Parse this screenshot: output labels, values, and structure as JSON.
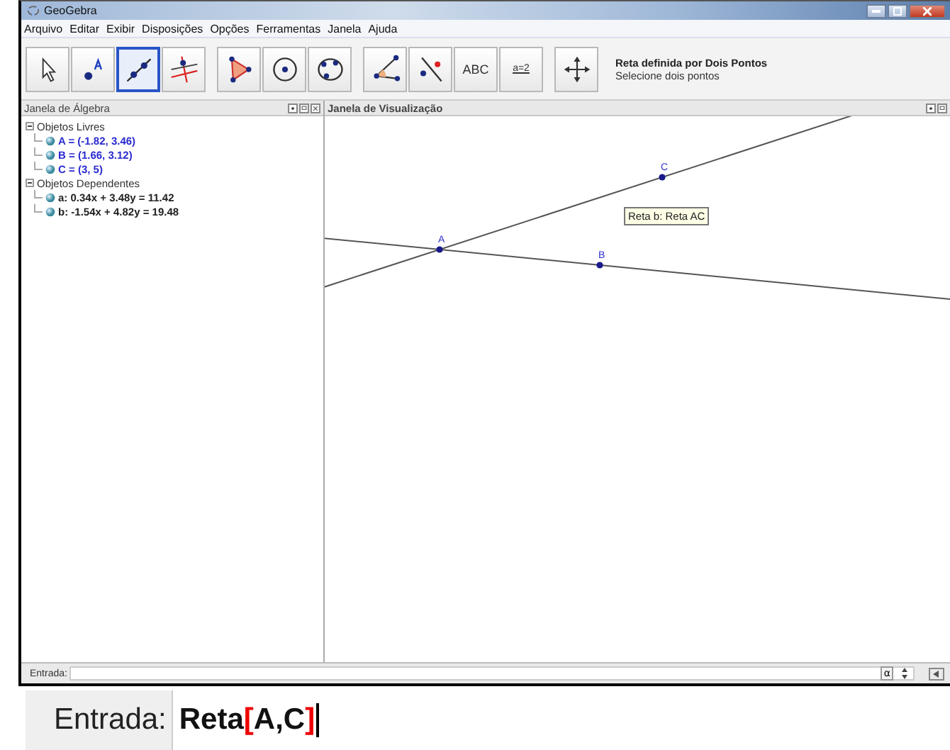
{
  "window": {
    "title": "GeoGebra"
  },
  "menu": [
    "Arquivo",
    "Editar",
    "Exibir",
    "Disposições",
    "Opções",
    "Ferramentas",
    "Janela",
    "Ajuda"
  ],
  "toolbar": {
    "groups": [
      [
        {
          "kind": "pointer",
          "selected": false
        },
        {
          "kind": "point",
          "selected": false
        },
        {
          "kind": "line",
          "selected": true
        },
        {
          "kind": "perpendicular",
          "selected": false
        }
      ],
      [
        {
          "kind": "polygon",
          "selected": false
        },
        {
          "kind": "circle",
          "selected": false
        },
        {
          "kind": "conic",
          "selected": false
        }
      ],
      [
        {
          "kind": "angle",
          "selected": false
        },
        {
          "kind": "reflect",
          "selected": false
        },
        {
          "kind": "text",
          "label": "ABC",
          "selected": false
        },
        {
          "kind": "slider",
          "label": "a=2",
          "selected": false
        }
      ],
      [
        {
          "kind": "move",
          "selected": false
        }
      ]
    ],
    "tool_title": "Reta definida por Dois Pontos",
    "tool_help": "Selecione dois pontos"
  },
  "algebra": {
    "title": "Janela de Álgebra",
    "groups": [
      {
        "label": "Objetos Livres",
        "kind": "free",
        "expanded": true,
        "children": [
          {
            "text": "A = (-1.82, 3.46)"
          },
          {
            "text": "B = (1.66, 3.12)"
          },
          {
            "text": "C = (3, 5)"
          }
        ]
      },
      {
        "label": "Objetos Dependentes",
        "kind": "dependent",
        "expanded": true,
        "children": [
          {
            "text": "a: 0.34x + 3.48y = 11.42"
          },
          {
            "text": "b: -1.54x + 4.82y = 19.48"
          }
        ]
      }
    ]
  },
  "graphics": {
    "title": "Janela de Visualização",
    "points": [
      {
        "label": "A"
      },
      {
        "label": "B"
      },
      {
        "label": "C"
      }
    ],
    "tooltip": "Reta b: Reta AC"
  },
  "input_bar": {
    "label": "Entrada:",
    "alpha": "α"
  },
  "zoomed_input": {
    "label": "Entrada:",
    "value": "Reta[A,C]"
  }
}
